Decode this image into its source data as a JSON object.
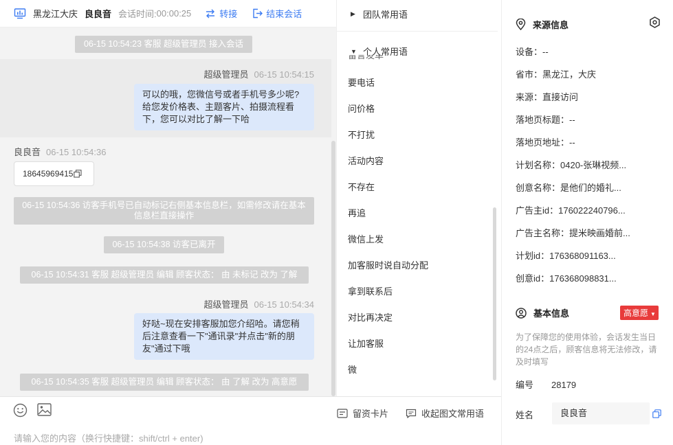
{
  "header": {
    "location": "黑龙江大庆",
    "visitor_name": "良良音",
    "time_label": "会话时间:",
    "time_value": "00:00:25",
    "transfer_label": "转接",
    "end_label": "结束会话"
  },
  "messages": {
    "sys1": "06-15 10:54:23 客服 超级管理员 接入会话",
    "agent1_name": "超级管理员",
    "agent1_time": "06-15 10:54:15",
    "agent1_text": "可以的哦，您微信号或者手机号多少呢?给您发价格表、主题客片、拍摄流程看下，您可以对比了解一下哈",
    "visitor_name": "良良音",
    "visitor_time": "06-15 10:54:36",
    "visitor_text": "18645969415",
    "sys2": "06-15 10:54:36 访客手机号已自动标记右侧基本信息栏，如需修改请在基本信息栏直接操作",
    "sys3": "06-15 10:54:38 访客已离开",
    "sys4": "06-15 10:54:31 客服 超级管理员 编辑 顾客状态： 由 未标记 改为 了解",
    "agent2_name": "超级管理员",
    "agent2_time": "06-15 10:54:34",
    "agent2_text": "好哒~现在安排客服加您介绍哈。请您稍后注意查看一下\"通讯录\"并点击\"新的朋友\"通过下哦",
    "sys5": "06-15 10:54:35 客服 超级管理员 编辑 顾客状态： 由 了解 改为 高意愿"
  },
  "composer": {
    "placeholder": "请输入您的内容（换行快捷键：shift/ctrl + enter)",
    "card_label": "留资卡片",
    "collapse_label": "收起图文常用语"
  },
  "phrases": {
    "team_group": "团队常用语",
    "personal_group": "个人常用语",
    "cut_item": "留言发单",
    "items": [
      "要电话",
      "问价格",
      "不打扰",
      "活动内容",
      "不存在",
      "再追",
      "微信上发",
      "加客服时说自动分配",
      "拿到联系后",
      "对比再决定",
      "让加客服",
      "微"
    ]
  },
  "info": {
    "source_title": "来源信息",
    "rows": [
      "设备：--",
      "省市：黑龙江，大庆",
      "来源：直接访问",
      "落地页标题：--",
      "落地页地址：--",
      "计划名称：0420-张琳视频...",
      "创意名称：是他们的婚礼...",
      "广告主id：176022240796...",
      "广告主名称：提米映画婚前...",
      "计划id：176368091163...",
      "创意id：176368098831..."
    ],
    "basic_title": "基本信息",
    "intent_tag": "高意愿",
    "note": "为了保障您的使用体验，会话发生当日的24点之后，顾客信息将无法修改，请及时填写",
    "id_label": "编号",
    "id_value": "28179",
    "name_label": "姓名",
    "name_value": "良良音"
  },
  "colors": {
    "accent": "#3d7cf2",
    "bubble": "#dce8fb",
    "system_msg": "#d2d2d2",
    "tag_red": "#e83b3b"
  }
}
